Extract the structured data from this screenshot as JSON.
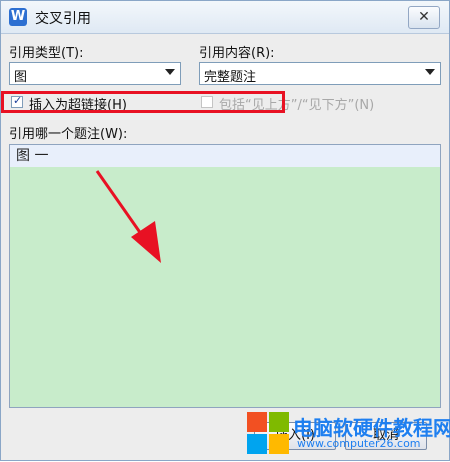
{
  "window": {
    "title": "交叉引用",
    "app_icon_letter": "W",
    "close_glyph": "✕"
  },
  "reference_type": {
    "label": "引用类型(T):",
    "value": "图"
  },
  "reference_content": {
    "label": "引用内容(R):",
    "value": "完整题注"
  },
  "insert_hyperlink": {
    "label": "插入为超链接(H)",
    "checked": true
  },
  "include_position": {
    "label": "包括“见上方”/“见下方”(N)",
    "checked": false,
    "enabled": false
  },
  "caption_list": {
    "label": "引用哪一个题注(W):",
    "items": [
      "图 一"
    ]
  },
  "buttons": {
    "insert": "插入(I)",
    "cancel": "取消"
  },
  "watermark": {
    "title": "电脑软硬件教程网",
    "url": "www.computer26.com"
  },
  "colors": {
    "highlight": "#e81123",
    "list_background": "#c8eccb",
    "arrow": "#e81123",
    "watermark_text": "#1e7ff0"
  }
}
